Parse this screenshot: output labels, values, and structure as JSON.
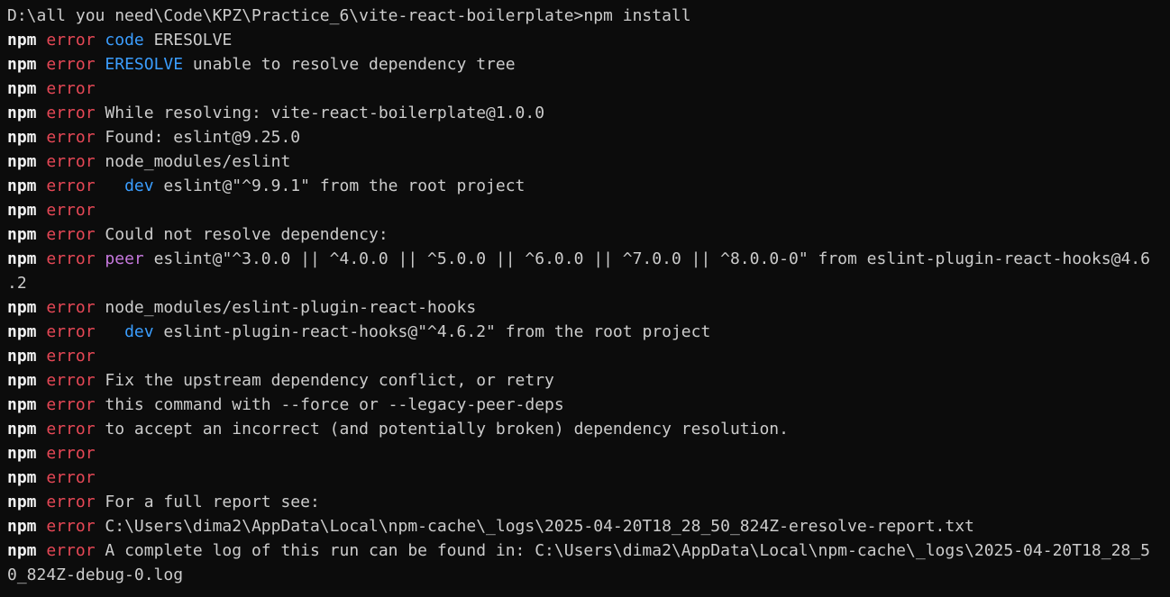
{
  "colors": {
    "background": "#0c0c0c",
    "text": "#cccccc",
    "npm": "#f2f2f2",
    "error": "#e74856",
    "keyword_blue": "#3b9eff",
    "keyword_peer": "#c678dd"
  },
  "prompt": "D:\\all you need\\Code\\KPZ\\Practice_6\\vite-react-boilerplate>npm install",
  "npm_label": "npm",
  "error_label": "error",
  "lines": [
    {
      "kw": "code",
      "kw_type": "blue",
      "text": " ERESOLVE"
    },
    {
      "kw": "ERESOLVE",
      "kw_type": "blue",
      "text": " unable to resolve dependency tree"
    },
    {
      "kw": "",
      "kw_type": "",
      "text": ""
    },
    {
      "kw": "",
      "kw_type": "",
      "text": "While resolving: vite-react-boilerplate@1.0.0"
    },
    {
      "kw": "",
      "kw_type": "",
      "text": "Found: eslint@9.25.0"
    },
    {
      "kw": "",
      "kw_type": "",
      "text": "node_modules/eslint"
    },
    {
      "indent": "  ",
      "kw": "dev",
      "kw_type": "blue",
      "text": " eslint@\"^9.9.1\" from the root project"
    },
    {
      "kw": "",
      "kw_type": "",
      "text": ""
    },
    {
      "kw": "",
      "kw_type": "",
      "text": "Could not resolve dependency:"
    },
    {
      "kw": "peer",
      "kw_type": "peer",
      "text": " eslint@\"^3.0.0 || ^4.0.0 || ^5.0.0 || ^6.0.0 || ^7.0.0 || ^8.0.0-0\" from eslint-plugin-react-hooks@4.6",
      "wrap": ".2"
    },
    {
      "kw": "",
      "kw_type": "",
      "text": "node_modules/eslint-plugin-react-hooks"
    },
    {
      "indent": "  ",
      "kw": "dev",
      "kw_type": "blue",
      "text": " eslint-plugin-react-hooks@\"^4.6.2\" from the root project"
    },
    {
      "kw": "",
      "kw_type": "",
      "text": ""
    },
    {
      "kw": "",
      "kw_type": "",
      "text": "Fix the upstream dependency conflict, or retry"
    },
    {
      "kw": "",
      "kw_type": "",
      "text": "this command with --force or --legacy-peer-deps"
    },
    {
      "kw": "",
      "kw_type": "",
      "text": "to accept an incorrect (and potentially broken) dependency resolution."
    },
    {
      "kw": "",
      "kw_type": "",
      "text": ""
    },
    {
      "kw": "",
      "kw_type": "",
      "text": ""
    },
    {
      "kw": "",
      "kw_type": "",
      "text": "For a full report see:"
    },
    {
      "kw": "",
      "kw_type": "",
      "text": "C:\\Users\\dima2\\AppData\\Local\\npm-cache\\_logs\\2025-04-20T18_28_50_824Z-eresolve-report.txt"
    },
    {
      "kw": "",
      "kw_type": "",
      "text": "A complete log of this run can be found in: C:\\Users\\dima2\\AppData\\Local\\npm-cache\\_logs\\2025-04-20T18_28_5",
      "wrap": "0_824Z-debug-0.log"
    }
  ]
}
